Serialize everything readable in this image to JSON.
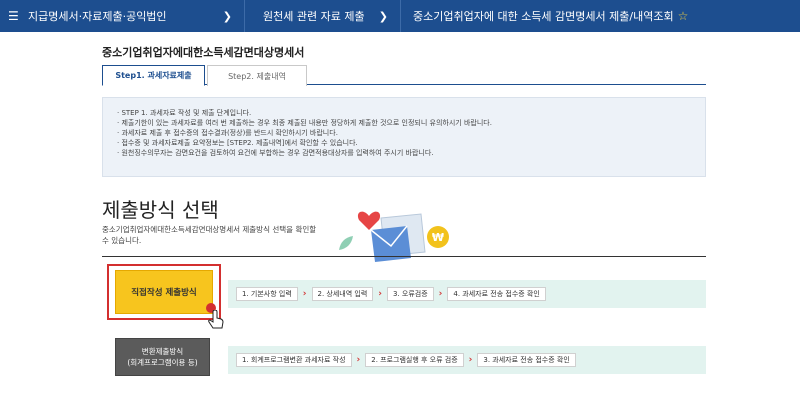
{
  "nav": {
    "menu_icon": "☰",
    "seg1": "지급명세서·자료제출·공익법인",
    "seg2": "원천세 관련 자료 제출",
    "seg3": "중소기업취업자에 대한 소득세 감면명세서 제출/내역조회",
    "chevron": "❯",
    "star": "☆"
  },
  "page": {
    "title": "중소기업취업자에대한소득세감면대상명세서"
  },
  "tabs": [
    {
      "label": "Step1. 과세자료제출"
    },
    {
      "label": "Step2. 제출내역"
    }
  ],
  "info_items": [
    "STEP 1. 과세자료 작성 및 제출 단계입니다.",
    "제출기한이 있는 과세자료를 여러 번 제출하는 경우 최종 제출된 내용만 정당하게 제출한 것으로 인정되니 유의하시기 바랍니다.",
    "과세자료 제출 후 접수증의 접수결과(정상)를 반드시 확인하시기 바랍니다.",
    "접수증 및 과세자료제출 요약정보는 [STEP2. 제출내역]에서 확인할 수 있습니다.",
    "원천징수의무자는 감면요건을 검토하여 요건에 부합하는 경우 감면적용대상자를 입력하여 주시기 바랍니다."
  ],
  "section": {
    "title": "제출방식 선택",
    "description": "중소기업취업자에대한소득세감면대상명세서 제출방식 선택을 확인할 수 있습니다."
  },
  "method1": {
    "label": "직접작성 제출방식",
    "steps": [
      "1. 기본사항 입력",
      "2. 상세내역 입력",
      "3. 오류검증",
      "4. 과세자료 전송 접수증 확인"
    ]
  },
  "method2": {
    "label_line1": "변환제출방식",
    "label_line2": "(회계프로그램이용 등)",
    "steps": [
      "1. 회계프로그램변환 과세자료 작성",
      "2. 프로그램실행 후 오류 검증",
      "3. 과세자료 전송 접수증 확인"
    ]
  },
  "flow_arrow": "›",
  "colors": {
    "nav_bg": "#1d4e8f",
    "accent_yellow": "#f7c51e",
    "highlight_red": "#d32f2f",
    "flow_bg": "#e2f3ef"
  }
}
